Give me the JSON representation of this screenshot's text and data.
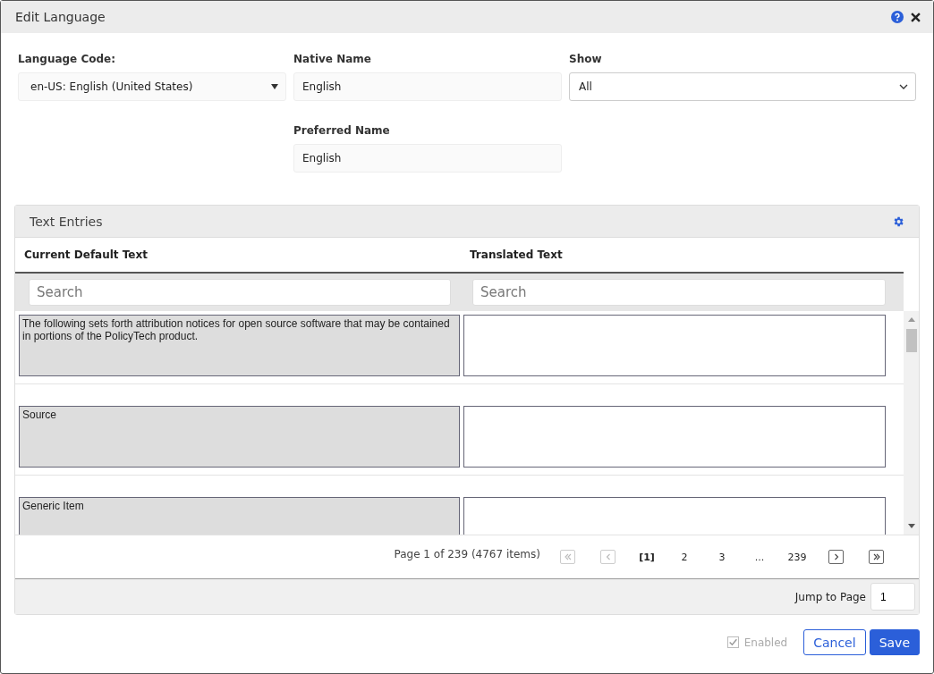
{
  "window": {
    "title": "Edit Language"
  },
  "form": {
    "language_code": {
      "label": "Language Code:",
      "value": "en-US: English (United States)"
    },
    "native_name": {
      "label": "Native Name",
      "value": "English"
    },
    "show": {
      "label": "Show",
      "value": "All"
    },
    "preferred_name": {
      "label": "Preferred Name",
      "value": "English"
    }
  },
  "text_entries": {
    "title": "Text Entries",
    "columns": [
      "Current Default Text",
      "Translated Text"
    ],
    "search_placeholders": [
      "Search",
      "Search"
    ],
    "rows": [
      {
        "default_text": "The following sets forth attribution notices for open source software that may be contained in portions of the PolicyTech product."
      },
      {
        "default_text": "Source"
      },
      {
        "default_text": "Generic Item"
      }
    ],
    "pager": {
      "summary": "Page 1 of 239 (4767 items)",
      "first": {
        "disabled": true
      },
      "prev": {
        "disabled": true
      },
      "pages": [
        {
          "label": "[1]",
          "selected": true
        },
        {
          "label": "2",
          "selected": false
        },
        {
          "label": "3",
          "selected": false
        },
        {
          "label": "...",
          "selected": false
        },
        {
          "label": "239",
          "selected": false
        }
      ],
      "next": {
        "disabled": false
      },
      "last": {
        "disabled": false
      }
    },
    "jump": {
      "label": "Jump to Page",
      "value": "1"
    }
  },
  "footer": {
    "enabled": {
      "label": "Enabled",
      "checked": true,
      "disabled": true
    },
    "buttons": [
      {
        "label": "Cancel",
        "kind": "secondary"
      },
      {
        "label": "Save",
        "kind": "primary"
      }
    ]
  }
}
